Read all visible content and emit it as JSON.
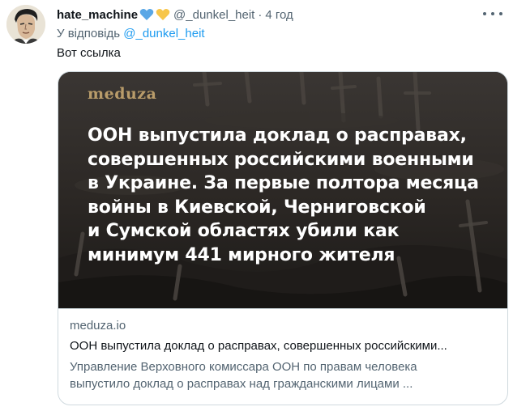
{
  "tweet": {
    "author": {
      "display_name": "hate_machine",
      "name_emoji": [
        "blue-heart-icon",
        "yellow-heart-icon"
      ],
      "handle": "@_dunkel_heit",
      "avatar": "avatar-illustrated-man"
    },
    "separator": "·",
    "time": "4 год",
    "reply_prefix": "У відповідь",
    "reply_to": "@_dunkel_heit",
    "text": "Вот ссылка",
    "more_icon": "more-horizontal-icon"
  },
  "card": {
    "image_logo": "meduza",
    "image_headline": [
      "ООН выпустила доклад о расправах,",
      "совершенных российскими военными",
      "в Украине. За первые полтора месяца",
      "войны в Киевской, Черниговской",
      "и Сумской областях убили как",
      "минимум 441 мирного жителя"
    ],
    "domain": "meduza.io",
    "title": "ООН выпустила доклад о расправах, совершенных российскими...",
    "description_lines": [
      "Управление Верховного комиссара ООН по правам человека",
      "выпустило доклад о расправах над гражданскими лицами ..."
    ]
  },
  "colors": {
    "link": "#1d9bf0",
    "muted": "#536471",
    "text": "#0f1419",
    "blue_heart": "#5aa7e6",
    "yellow_heart": "#f7c64a",
    "logo_gold": "#b99c6a"
  }
}
